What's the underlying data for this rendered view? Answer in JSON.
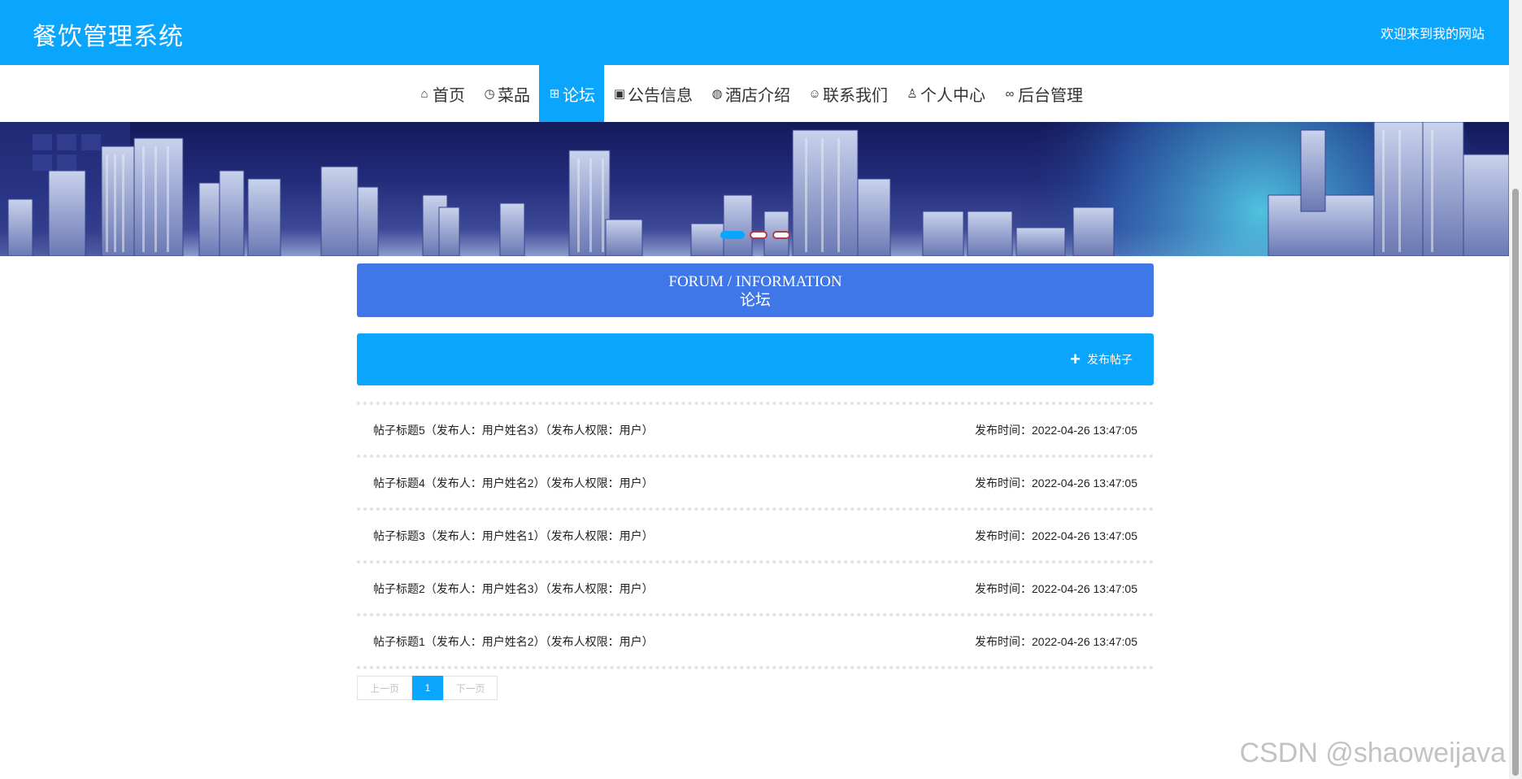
{
  "header": {
    "title": "餐饮管理系统",
    "welcome": "欢迎来到我的网站"
  },
  "nav": {
    "items": [
      {
        "label": "首页",
        "icon": "home-icon",
        "active": false
      },
      {
        "label": "菜品",
        "icon": "clock-icon",
        "active": false
      },
      {
        "label": "论坛",
        "icon": "grid-icon",
        "active": true
      },
      {
        "label": "公告信息",
        "icon": "gift-icon",
        "active": false
      },
      {
        "label": "酒店介绍",
        "icon": "globe-icon",
        "active": false
      },
      {
        "label": "联系我们",
        "icon": "smile-icon",
        "active": false
      },
      {
        "label": "个人中心",
        "icon": "user-icon",
        "active": false
      },
      {
        "label": "后台管理",
        "icon": "link-icon",
        "active": false
      }
    ]
  },
  "banner": {
    "slide_count": 3,
    "active_slide": 1
  },
  "section": {
    "title_en": "FORUM / INFORMATION",
    "title_cn": "论坛"
  },
  "actions": {
    "post_label": "发布帖子"
  },
  "posts": [
    {
      "title": "帖子标题5（发布人：用户姓名3）（发布人权限：用户）",
      "time": "发布时间：2022-04-26 13:47:05"
    },
    {
      "title": "帖子标题4（发布人：用户姓名2）（发布人权限：用户）",
      "time": "发布时间：2022-04-26 13:47:05"
    },
    {
      "title": "帖子标题3（发布人：用户姓名1）（发布人权限：用户）",
      "time": "发布时间：2022-04-26 13:47:05"
    },
    {
      "title": "帖子标题2（发布人：用户姓名3）（发布人权限：用户）",
      "time": "发布时间：2022-04-26 13:47:05"
    },
    {
      "title": "帖子标题1（发布人：用户姓名2）（发布人权限：用户）",
      "time": "发布时间：2022-04-26 13:47:05"
    }
  ],
  "pagination": {
    "prev": "上一页",
    "current": "1",
    "next": "下一页"
  },
  "watermark": "CSDN @shaoweijava",
  "colors": {
    "primary": "#0aa5fd",
    "title_box": "#3f77e9"
  }
}
